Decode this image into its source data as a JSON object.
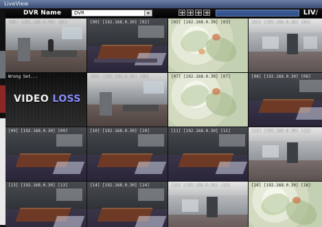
{
  "window": {
    "title_text": "LiveView"
  },
  "left_strip": {
    "label": "s"
  },
  "toolbar": {
    "dvr_title": "DVR Name",
    "selected_dvr": "DVR",
    "layout_buttons": [
      {
        "name": "layout-1x1-button"
      },
      {
        "name": "layout-2x2-button"
      },
      {
        "name": "layout-3x3-button"
      },
      {
        "name": "layout-4x4-button"
      }
    ],
    "brand_text": "LIV",
    "brand_suffix": "/",
    "status_text": ""
  },
  "camera_grid": {
    "tiles": [
      {
        "caption": "[00] [192.168.0.30] [01]",
        "scene": "office",
        "selected": true
      },
      {
        "caption": "[00] [192.168.0.30] [02]",
        "scene": "meeting"
      },
      {
        "caption": "[03] [192.168.0.30] [03]",
        "scene": "plant"
      },
      {
        "caption": "[04] [192.168.0.30] [04]",
        "scene": "hall"
      },
      {
        "caption": "Wrong Set...",
        "scene": "video-loss",
        "video_loss_text_1": "VIDEO",
        "video_loss_text_2": "LOSS"
      },
      {
        "caption": "[06] [192.168.0.30] [06]",
        "scene": "office"
      },
      {
        "caption": "[07] [192.168.0.30] [07]",
        "scene": "plant"
      },
      {
        "caption": "[08] [192.168.0.30] [08]",
        "scene": "meeting"
      },
      {
        "caption": "[09] [192.168.0.30] [09]",
        "scene": "meeting"
      },
      {
        "caption": "[10] [192.168.0.30] [10]",
        "scene": "meeting"
      },
      {
        "caption": "[11] [192.168.0.30] [11]",
        "scene": "meeting"
      },
      {
        "caption": "[12] [192.168.0.30] [12]",
        "scene": "hall"
      },
      {
        "caption": "[13] [192.168.0.30] [13]",
        "scene": "meeting"
      },
      {
        "caption": "[14] [192.168.0.30] [14]",
        "scene": "meeting"
      },
      {
        "caption": "[15] [192.168.0.30] [15]",
        "scene": "hall"
      },
      {
        "caption": "[16] [192.168.0.30] [16]",
        "scene": "plant"
      }
    ]
  }
}
